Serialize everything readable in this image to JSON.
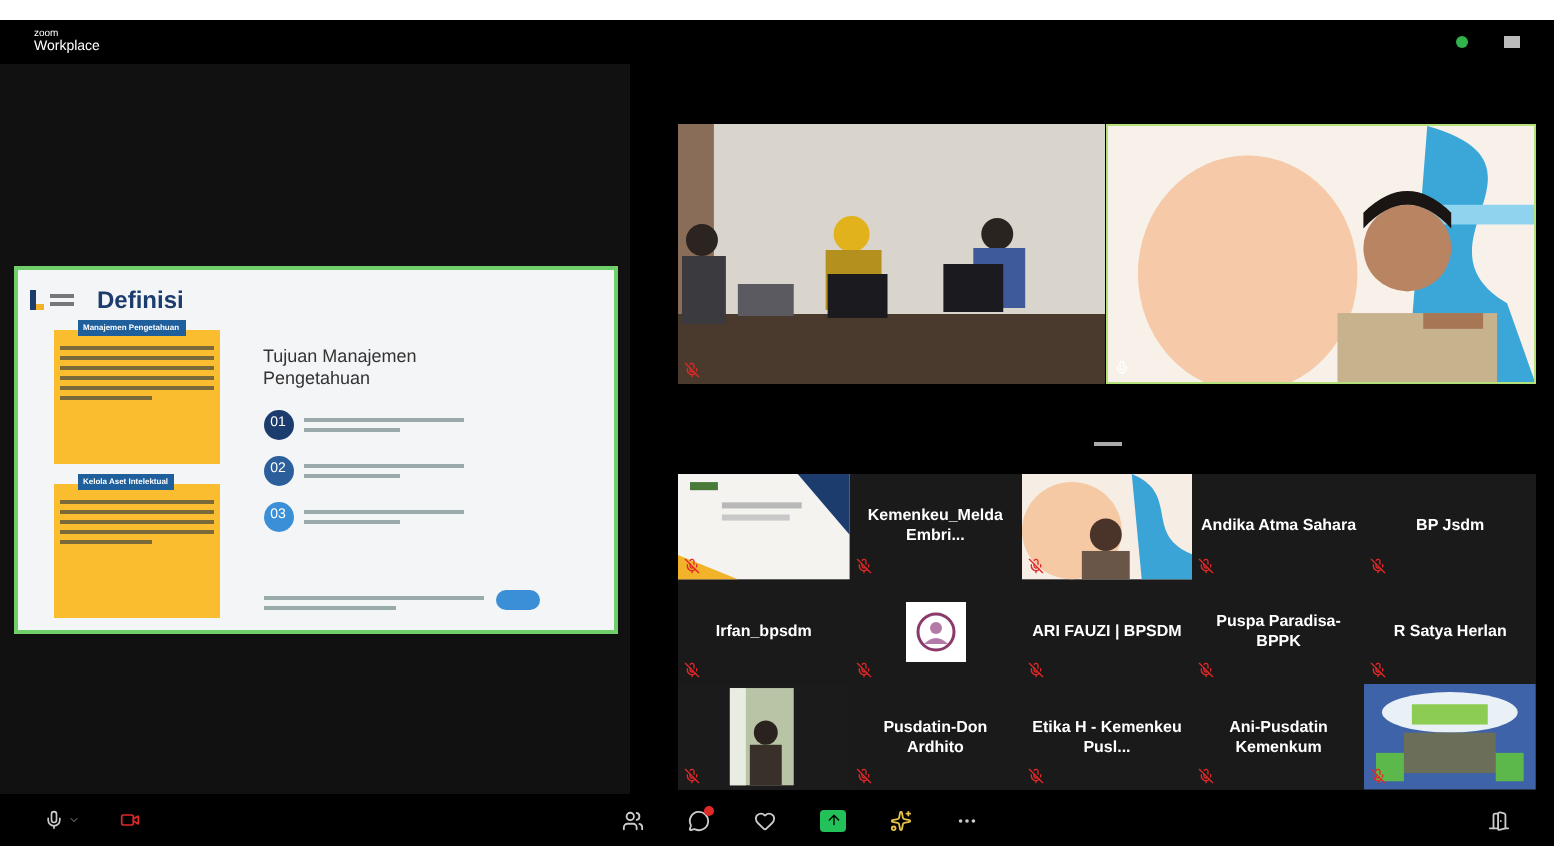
{
  "app": {
    "brand": "zoom",
    "title": "Workplace"
  },
  "slide": {
    "title": "Definisi",
    "boxes": [
      {
        "heading": "Manajemen Pengetahuan"
      },
      {
        "heading": "Kelola Aset Intelektual"
      }
    ],
    "goals_title": "Tujuan Manajemen Pengetahuan",
    "goals": [
      {
        "number": "01"
      },
      {
        "number": "02"
      },
      {
        "number": "03"
      }
    ]
  },
  "videos": [
    {
      "kind": "picture",
      "muted": true
    },
    {
      "kind": "picture",
      "muted": false
    }
  ],
  "tiles": [
    {
      "kind": "picture",
      "muted": true
    },
    {
      "kind": "name",
      "name": "Kemenkeu_Melda Embri...",
      "muted": true
    },
    {
      "kind": "picture",
      "muted": true
    },
    {
      "kind": "name",
      "name": "Andika Atma Sahara",
      "muted": true
    },
    {
      "kind": "name",
      "name": "BP Jsdm",
      "muted": true
    },
    {
      "kind": "name",
      "name": "Irfan_bpsdm",
      "muted": true
    },
    {
      "kind": "avatar",
      "muted": true
    },
    {
      "kind": "name",
      "name": "ARI FAUZI | BPSDM",
      "muted": true
    },
    {
      "kind": "name",
      "name": "Puspa Paradisa-BPPK",
      "muted": true
    },
    {
      "kind": "name",
      "name": "R Satya Herlan",
      "muted": true
    },
    {
      "kind": "picture",
      "muted": true
    },
    {
      "kind": "name",
      "name": "Pusdatin-Don Ardhito",
      "muted": true
    },
    {
      "kind": "name",
      "name": "Etika H - Kemenkeu Pusl...",
      "muted": true
    },
    {
      "kind": "name",
      "name": "Ani-Pusdatin Kemenkum",
      "muted": true
    },
    {
      "kind": "picture",
      "muted": true
    }
  ],
  "chat": {
    "unread": true
  }
}
